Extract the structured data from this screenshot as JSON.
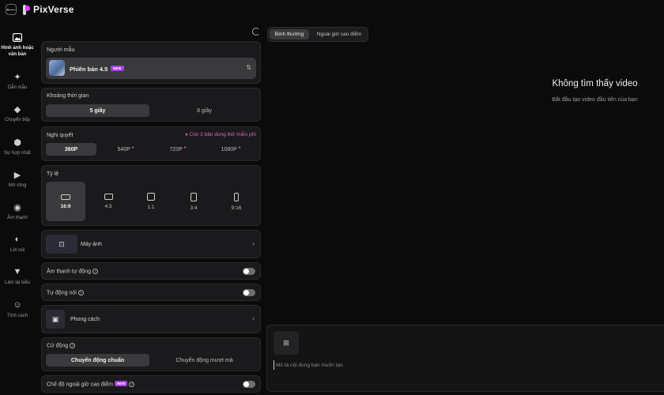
{
  "app": {
    "name": "PixVerse"
  },
  "sidebar": {
    "items": [
      {
        "label": "Hình ảnh hoặc văn bản",
        "icon": "image-text-icon",
        "active": true
      },
      {
        "label": "Dẫn mẫu",
        "icon": "sparkle-icon"
      },
      {
        "label": "Chuyển tiếp",
        "icon": "transition-icon"
      },
      {
        "label": "Sự hợp nhất",
        "icon": "fusion-icon"
      },
      {
        "label": "Mở rộng",
        "icon": "extend-icon"
      },
      {
        "label": "Âm thanh",
        "icon": "sound-icon"
      },
      {
        "label": "Lời nói",
        "icon": "lips-icon"
      },
      {
        "label": "Làm lại kiểu",
        "icon": "restyle-icon"
      },
      {
        "label": "Tính cách",
        "icon": "character-icon"
      }
    ]
  },
  "model": {
    "title": "Người mẫu",
    "name": "Phiên bản 4.5",
    "badge": "NEW"
  },
  "duration": {
    "title": "Khoảng thời gian",
    "options": [
      "5 giây",
      "8 giây"
    ],
    "selected": 0
  },
  "resolution": {
    "title": "Nghị quyết",
    "trial_note": "Còn 3 bản dùng thử miễn phí",
    "options": [
      "360P",
      "540P",
      "720P",
      "1080P"
    ],
    "selected": 0
  },
  "ratio": {
    "title": "Tỷ lệ",
    "options": [
      "16:9",
      "4:3",
      "1:1",
      "3:4",
      "9:16"
    ],
    "selected": 0
  },
  "camera": {
    "label": "Máy ảnh"
  },
  "auto_sound": {
    "label": "Âm thanh tự động",
    "enabled": false
  },
  "auto_speech": {
    "label": "Tự động nói",
    "enabled": false
  },
  "style": {
    "label": "Phong cách"
  },
  "motion": {
    "title": "Cử động",
    "options": [
      "Chuyển động chuẩn",
      "Chuyển động mượt mà"
    ],
    "selected": 0
  },
  "offpeak": {
    "label": "Chế độ ngoài giờ cao điểm",
    "badge": "NEW",
    "enabled": false
  },
  "mode_tabs": {
    "options": [
      "Bình thường",
      "Ngoài giờ cao điểm"
    ],
    "selected": 0
  },
  "empty_state": {
    "title": "Không tìm thấy video",
    "subtitle": "Bắt đầu tạo video đầu tiên của bạn"
  },
  "prompt": {
    "placeholder": "Mô tả nội dung bạn muốn tạo",
    "value": ""
  }
}
